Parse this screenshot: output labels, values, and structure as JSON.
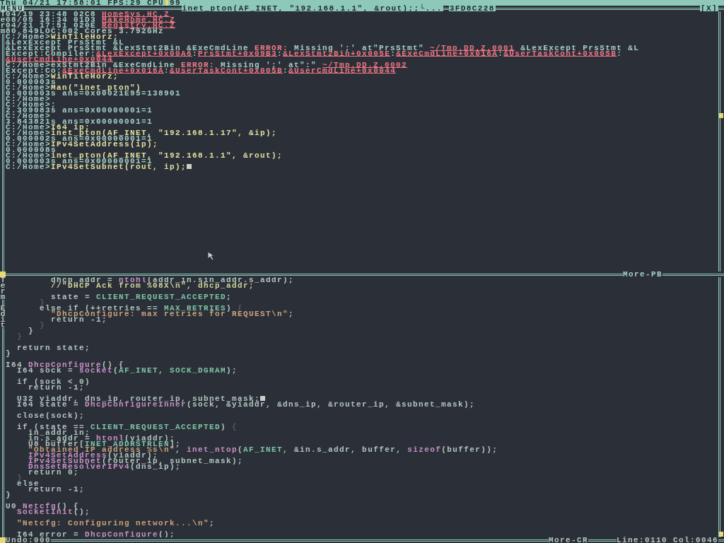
{
  "top_bar": {
    "clock": "Thu 04/21 17:58:01",
    "fps": "FPS:29",
    "cpu_label": "CPU",
    "cpu": "99"
  },
  "terminal": {
    "menu": "MENU",
    "title": "inet_pton(AF_INET, \"192.168.1.1\", &rout);;└...",
    "address": "3FD8C228",
    "close": "[X]",
    "side_labels": [
      "Term"
    ],
    "footer": "More-PB",
    "lines": [
      {
        "kind": "text",
        "segments": [
          {
            "text": "04/19 23:48 02C8 ",
            "kind": "plain"
          },
          {
            "text": "HomeSys.HC.Z",
            "kind": "link"
          }
        ]
      },
      {
        "kind": "text",
        "segments": [
          {
            "text": "08/05 16:34 01D3 ",
            "kind": "plain"
          },
          {
            "text": "MakeHome.HC.Z",
            "kind": "link"
          }
        ]
      },
      {
        "kind": "text",
        "segments": [
          {
            "text": "04/21 17:51 020E ",
            "kind": "plain"
          },
          {
            "text": "Registry.HC.Z",
            "kind": "link"
          }
        ]
      },
      {
        "kind": "text",
        "segments": [
          {
            "text": "80,849LOC:002 Cores 3.792GHz",
            "kind": "plain"
          }
        ]
      },
      {
        "kind": "text",
        "segments": [
          {
            "text": "C:/Home>",
            "kind": "plain"
          },
          {
            "text": "WinTileHorz;",
            "kind": "cmd"
          }
        ]
      },
      {
        "kind": "text",
        "segments": [
          {
            "text": "&LexExcept PrsStmt &L",
            "kind": "plain"
          }
        ]
      },
      {
        "kind": "text",
        "segments": [
          {
            "text": "&LexExcept PrsStmt &LexStmt2Bin &ExeCmdLine ",
            "kind": "plain"
          },
          {
            "text": "ERROR:",
            "kind": "error"
          },
          {
            "text": " Missing ';' at\"PrsStmt\" ",
            "kind": "plain"
          },
          {
            "text": "~/Tmp.DD.Z.0001",
            "kind": "link"
          },
          {
            "text": " &LexExcept PrsStmt &L",
            "kind": "plain"
          }
        ]
      },
      {
        "kind": "text",
        "segments": [
          {
            "text": "Except:Compiler:",
            "kind": "plain"
          },
          {
            "text": "&LexExcept+0x00A6",
            "kind": "link"
          },
          {
            "text": ":",
            "kind": "plain"
          },
          {
            "text": "PrsStmt+0x09B3",
            "kind": "link"
          },
          {
            "text": ":",
            "kind": "plain"
          },
          {
            "text": "&LexStmt2Bin+0x005E",
            "kind": "link"
          },
          {
            "text": ":",
            "kind": "plain"
          },
          {
            "text": "&ExeCmdLine+0x016A",
            "kind": "link"
          },
          {
            "text": ":",
            "kind": "plain"
          },
          {
            "text": "&UserTaskCont+0x005B",
            "kind": "link"
          },
          {
            "text": ":",
            "kind": "plain"
          }
        ]
      },
      {
        "kind": "text",
        "segments": [
          {
            "text": "&UserCmdLine+0x0044",
            "kind": "link"
          }
        ]
      },
      {
        "kind": "text",
        "segments": [
          {
            "text": "C:/Home>exStmt2Bin &ExeCmdLine ",
            "kind": "plain"
          },
          {
            "text": "ERROR:",
            "kind": "error"
          },
          {
            "text": " Missing ';' at\":\" ",
            "kind": "plain"
          },
          {
            "text": "~/Tmp.DD.Z.0002",
            "kind": "link"
          }
        ]
      },
      {
        "kind": "text",
        "segments": [
          {
            "text": "Except:Co:",
            "kind": "plain"
          },
          {
            "text": "&ExeCmdLine+0x016A",
            "kind": "link"
          },
          {
            "text": ":",
            "kind": "plain"
          },
          {
            "text": "&UserTaskCont+0x005B",
            "kind": "link"
          },
          {
            "text": ":",
            "kind": "plain"
          },
          {
            "text": "&UserCmdLine+0x0044",
            "kind": "link"
          }
        ]
      },
      {
        "kind": "text",
        "segments": [
          {
            "text": "C:/Home>",
            "kind": "plain"
          },
          {
            "text": "WinTileHorz;",
            "kind": "cmd"
          }
        ]
      },
      {
        "kind": "text",
        "segments": [
          {
            "text": "0.000003s",
            "kind": "plain"
          }
        ]
      },
      {
        "kind": "text",
        "segments": [
          {
            "text": "C:/Home>",
            "kind": "plain"
          },
          {
            "text": "Man(\"inet_pton\")",
            "kind": "cmd"
          }
        ]
      },
      {
        "kind": "text",
        "segments": [
          {
            "text": "0.000003s ans=0x00021E95=138901",
            "kind": "plain"
          }
        ]
      },
      {
        "kind": "text",
        "segments": [
          {
            "text": "C:/Home>",
            "kind": "plain"
          }
        ]
      },
      {
        "kind": "text",
        "segments": [
          {
            "text": "C:/Home>;",
            "kind": "plain"
          }
        ]
      },
      {
        "kind": "text",
        "segments": [
          {
            "text": "2.309083s ans=0x00000001=1",
            "kind": "plain"
          }
        ]
      },
      {
        "kind": "text",
        "segments": [
          {
            "text": "C:/Home>",
            "kind": "plain"
          }
        ]
      },
      {
        "kind": "text",
        "segments": [
          {
            "text": "3.843821s ans=0x00000001=1",
            "kind": "plain"
          }
        ]
      },
      {
        "kind": "text",
        "segments": [
          {
            "text": "C:/Home>",
            "kind": "plain"
          },
          {
            "text": "I64 ip;",
            "kind": "cmd"
          }
        ]
      },
      {
        "kind": "text",
        "segments": [
          {
            "text": "C:/Home>",
            "kind": "plain"
          },
          {
            "text": "inet_pton(AF_INET, \"192.168.1.17\", &ip);",
            "kind": "cmd"
          }
        ]
      },
      {
        "kind": "text",
        "segments": [
          {
            "text": "0.000002s ans=0x00000001=1",
            "kind": "plain"
          }
        ]
      },
      {
        "kind": "text",
        "segments": [
          {
            "text": "C:/Home>",
            "kind": "plain"
          },
          {
            "text": "IPv4SetAddress(ip);",
            "kind": "cmd"
          }
        ]
      },
      {
        "kind": "text",
        "segments": [
          {
            "text": "0.000008s",
            "kind": "plain"
          }
        ]
      },
      {
        "kind": "text",
        "segments": [
          {
            "text": "C:/Home>",
            "kind": "plain"
          },
          {
            "text": "inet_pton(AF_INET, \"192.168.1.1\", &rout);",
            "kind": "cmd"
          }
        ]
      },
      {
        "kind": "text",
        "segments": [
          {
            "text": "0.000003s ans=0x00000001=1",
            "kind": "plain"
          }
        ]
      },
      {
        "kind": "text",
        "cursor": true,
        "segments": [
          {
            "text": "C:/Home>",
            "kind": "plain"
          },
          {
            "text": "IPv4SetSubnet(rout, ip);",
            "kind": "cmd"
          }
        ]
      }
    ]
  },
  "editor": {
    "side_labels": [
      "Term",
      "Edit"
    ],
    "undo": "Undo:000",
    "footer": "More-CR",
    "position": "Line:0110 Col:0046",
    "lines": [
      {
        "kind": "text",
        "segments": [
          {
            "text": "        dhcp_addr = ",
            "kind": "plain"
          },
          {
            "text": "ntohl",
            "kind": "fn"
          },
          {
            "text": "(addr_in.sin_addr.s_addr);",
            "kind": "plain"
          }
        ]
      },
      {
        "kind": "text",
        "segments": [
          {
            "text": "        //\"DHCP Ack from %08X\\n\", dhcp_addr;",
            "kind": "comment"
          }
        ]
      },
      {
        "kind": "blank"
      },
      {
        "kind": "text",
        "segments": [
          {
            "text": "        state = ",
            "kind": "plain"
          },
          {
            "text": "CLIENT_REQUEST_ACCEPTED",
            "kind": "const"
          },
          {
            "text": ";",
            "kind": "plain"
          }
        ]
      },
      {
        "kind": "text",
        "segments": [
          {
            "text": "      }",
            "kind": "dim"
          }
        ]
      },
      {
        "kind": "text",
        "segments": [
          {
            "text": "      else if (++retries == ",
            "kind": "plain"
          },
          {
            "text": "MAX_RETRIES",
            "kind": "const"
          },
          {
            "text": ") ",
            "kind": "plain"
          },
          {
            "text": "{",
            "kind": "dim"
          }
        ]
      },
      {
        "kind": "text",
        "segments": [
          {
            "text": "        \"DhcpConfigure: max retries for REQUEST\\n\"",
            "kind": "string"
          },
          {
            "text": ";",
            "kind": "plain"
          }
        ]
      },
      {
        "kind": "text",
        "segments": [
          {
            "text": "        return -1;",
            "kind": "plain"
          }
        ]
      },
      {
        "kind": "text",
        "segments": [
          {
            "text": "      }",
            "kind": "dim"
          }
        ]
      },
      {
        "kind": "text",
        "segments": [
          {
            "text": "    }",
            "kind": "plain"
          }
        ]
      },
      {
        "kind": "text",
        "segments": [
          {
            "text": "  }",
            "kind": "dim"
          }
        ]
      },
      {
        "kind": "blank"
      },
      {
        "kind": "text",
        "segments": [
          {
            "text": "  return state;",
            "kind": "plain"
          }
        ]
      },
      {
        "kind": "text",
        "segments": [
          {
            "text": "}",
            "kind": "plain"
          }
        ]
      },
      {
        "kind": "blank"
      },
      {
        "kind": "text",
        "segments": [
          {
            "text": "I64 ",
            "kind": "plain"
          },
          {
            "text": "DhcpConfigure",
            "kind": "fn"
          },
          {
            "text": "() {",
            "kind": "plain"
          }
        ]
      },
      {
        "kind": "text",
        "segments": [
          {
            "text": "  I64 sock = ",
            "kind": "plain"
          },
          {
            "text": "socket",
            "kind": "fn"
          },
          {
            "text": "(",
            "kind": "plain"
          },
          {
            "text": "AF_INET",
            "kind": "const"
          },
          {
            "text": ", ",
            "kind": "plain"
          },
          {
            "text": "SOCK_DGRAM",
            "kind": "const"
          },
          {
            "text": ");",
            "kind": "plain"
          }
        ]
      },
      {
        "kind": "blank"
      },
      {
        "kind": "text",
        "segments": [
          {
            "text": "  if (sock < 0)",
            "kind": "plain"
          }
        ]
      },
      {
        "kind": "text",
        "segments": [
          {
            "text": "    return -1;",
            "kind": "plain"
          }
        ]
      },
      {
        "kind": "blank"
      },
      {
        "kind": "text",
        "cursor": true,
        "segments": [
          {
            "text": "  U32 yiaddr, dns_ip, router_ip, subnet_mask;",
            "kind": "plain"
          }
        ]
      },
      {
        "kind": "text",
        "segments": [
          {
            "text": "  I64 state = ",
            "kind": "plain"
          },
          {
            "text": "DhcpConfigureInner",
            "kind": "fn"
          },
          {
            "text": "(sock, &yiaddr, &dns_ip, &router_ip, &subnet_mask);",
            "kind": "plain"
          }
        ]
      },
      {
        "kind": "blank"
      },
      {
        "kind": "text",
        "segments": [
          {
            "text": "  close(sock);",
            "kind": "plain"
          }
        ]
      },
      {
        "kind": "blank"
      },
      {
        "kind": "text",
        "segments": [
          {
            "text": "  if (state == ",
            "kind": "plain"
          },
          {
            "text": "CLIENT_REQUEST_ACCEPTED",
            "kind": "const"
          },
          {
            "text": ") ",
            "kind": "plain"
          },
          {
            "text": "{",
            "kind": "dim"
          }
        ]
      },
      {
        "kind": "text",
        "segments": [
          {
            "text": "    in_addr in;",
            "kind": "plain"
          }
        ]
      },
      {
        "kind": "text",
        "segments": [
          {
            "text": "    in.s_addr = ",
            "kind": "plain"
          },
          {
            "text": "htonl",
            "kind": "fn"
          },
          {
            "text": "(yiaddr);",
            "kind": "plain"
          }
        ]
      },
      {
        "kind": "text",
        "segments": [
          {
            "text": "    U8 buffer[",
            "kind": "plain"
          },
          {
            "text": "INET_ADDRSTRLEN",
            "kind": "const"
          },
          {
            "text": "];",
            "kind": "plain"
          }
        ]
      },
      {
        "kind": "text",
        "segments": [
          {
            "text": "    \"Obtained IP address %s\\n\"",
            "kind": "string"
          },
          {
            "text": ", ",
            "kind": "plain"
          },
          {
            "text": "inet_ntop",
            "kind": "fn"
          },
          {
            "text": "(",
            "kind": "plain"
          },
          {
            "text": "AF_INET",
            "kind": "const"
          },
          {
            "text": ", &in.s_addr, buffer, ",
            "kind": "plain"
          },
          {
            "text": "sizeof",
            "kind": "fn"
          },
          {
            "text": "(buffer));",
            "kind": "plain"
          }
        ]
      },
      {
        "kind": "text",
        "segments": [
          {
            "text": "    IPv4SetAddress",
            "kind": "fn"
          },
          {
            "text": "(yiaddr);",
            "kind": "plain"
          }
        ]
      },
      {
        "kind": "text",
        "segments": [
          {
            "text": "    IPv4SetSubnet",
            "kind": "fn"
          },
          {
            "text": "(router_ip, subnet_mask);",
            "kind": "plain"
          }
        ]
      },
      {
        "kind": "text",
        "segments": [
          {
            "text": "    DnsSetResolverIPv4",
            "kind": "fn"
          },
          {
            "text": "(dns_ip);",
            "kind": "plain"
          }
        ]
      },
      {
        "kind": "text",
        "segments": [
          {
            "text": "    return 0;",
            "kind": "plain"
          }
        ]
      },
      {
        "kind": "text",
        "segments": [
          {
            "text": "  }",
            "kind": "dim"
          }
        ]
      },
      {
        "kind": "text",
        "segments": [
          {
            "text": "  else",
            "kind": "plain"
          }
        ]
      },
      {
        "kind": "text",
        "segments": [
          {
            "text": "    return -1;",
            "kind": "plain"
          }
        ]
      },
      {
        "kind": "text",
        "segments": [
          {
            "text": "}",
            "kind": "plain"
          }
        ]
      },
      {
        "kind": "blank"
      },
      {
        "kind": "text",
        "segments": [
          {
            "text": "U0 ",
            "kind": "plain"
          },
          {
            "text": "Netcfg",
            "kind": "fn"
          },
          {
            "text": "() {",
            "kind": "plain"
          }
        ]
      },
      {
        "kind": "text",
        "segments": [
          {
            "text": "  SocketInit",
            "kind": "fn"
          },
          {
            "text": "();",
            "kind": "plain"
          }
        ]
      },
      {
        "kind": "blank"
      },
      {
        "kind": "text",
        "segments": [
          {
            "text": "  \"Netcfg: Configuring network...\\n\"",
            "kind": "string"
          },
          {
            "text": ";",
            "kind": "plain"
          }
        ]
      },
      {
        "kind": "blank"
      },
      {
        "kind": "text",
        "segments": [
          {
            "text": "  I64 error = ",
            "kind": "plain"
          },
          {
            "text": "DhcpConfigure",
            "kind": "fn"
          },
          {
            "text": "();",
            "kind": "plain"
          }
        ]
      }
    ]
  }
}
